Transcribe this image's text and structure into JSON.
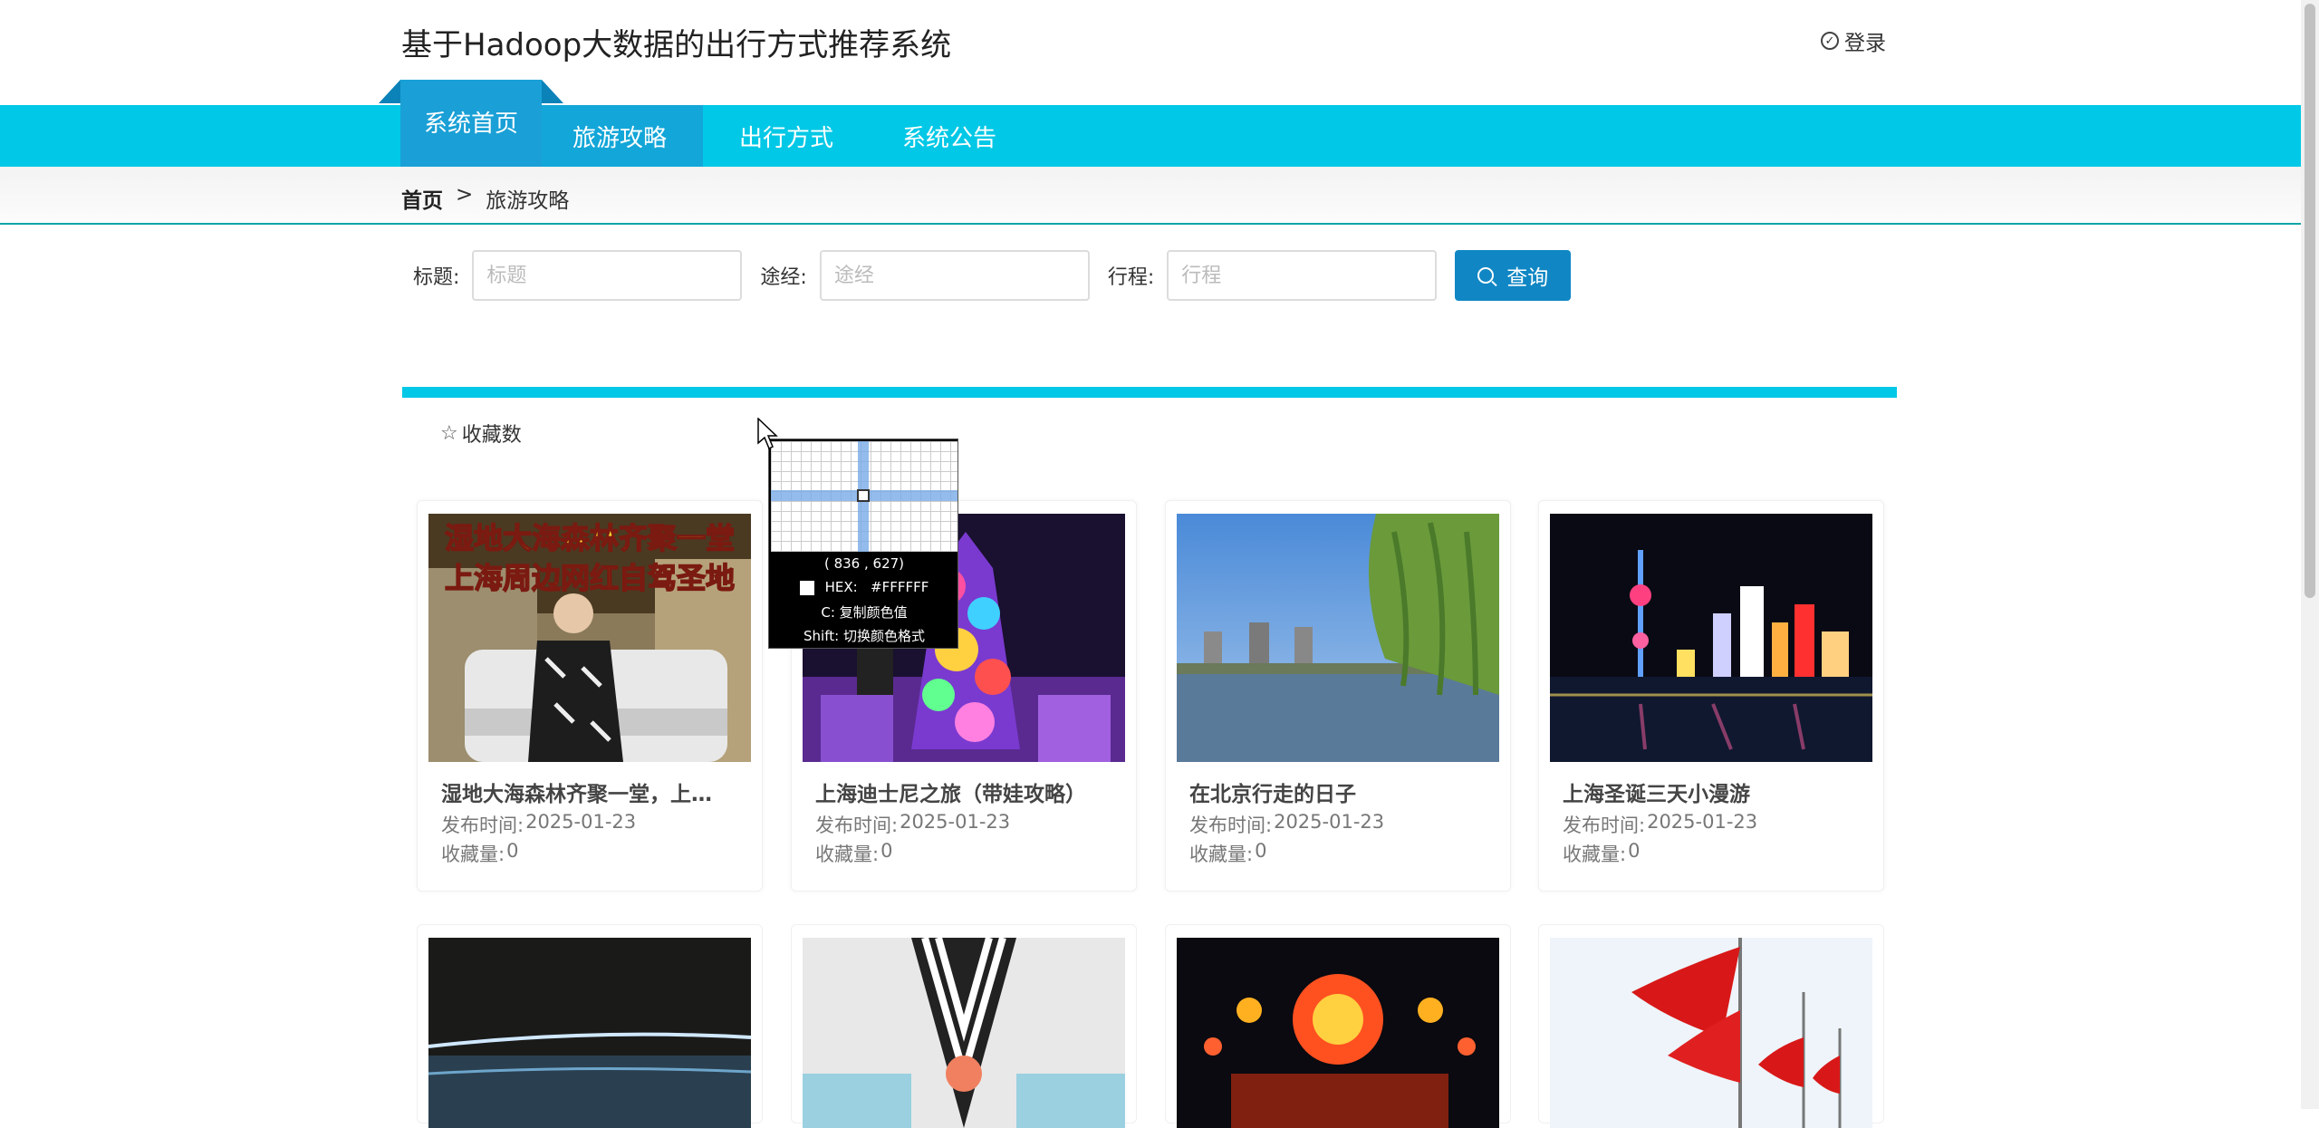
{
  "header": {
    "site_title": "基于Hadoop大数据的出行方式推荐系统",
    "login_label": "登录",
    "login_icon": "check-circle-icon"
  },
  "nav": {
    "items": [
      {
        "label": "系统首页"
      },
      {
        "label": "旅游攻略"
      },
      {
        "label": "出行方式"
      },
      {
        "label": "系统公告"
      }
    ]
  },
  "breadcrumb": {
    "home": "首页",
    "separator": ">",
    "current": "旅游攻略"
  },
  "search": {
    "title_label": "标题:",
    "title_placeholder": "标题",
    "route_label": "途经:",
    "route_placeholder": "途经",
    "trip_label": "行程:",
    "trip_placeholder": "行程",
    "button_label": "查询"
  },
  "sort": {
    "fav_label": "收藏数"
  },
  "cards": [
    {
      "title": "湿地大海森林齐聚一堂，上海...",
      "date_label": "发布时间:",
      "date": "2025-01-23",
      "fav_label": "收藏量:",
      "fav": "0"
    },
    {
      "title": "上海迪士尼之旅（带娃攻略）",
      "date_label": "发布时间:",
      "date": "2025-01-23",
      "fav_label": "收藏量:",
      "fav": "0"
    },
    {
      "title": "在北京行走的日子",
      "date_label": "发布时间:",
      "date": "2025-01-23",
      "fav_label": "收藏量:",
      "fav": "0"
    },
    {
      "title": "上海圣诞三天小漫游",
      "date_label": "发布时间:",
      "date": "2025-01-23",
      "fav_label": "收藏量:",
      "fav": "0"
    }
  ],
  "thumb_text": {
    "line1": "湿地大海森林齐聚一堂",
    "line2": "上海周边网红自驾圣地"
  },
  "picker": {
    "coords": "( 836 , 627)",
    "hex_label": "HEX:",
    "hex_value": "#FFFFFF",
    "copy_hint": "C: 复制颜色值",
    "shift_hint": "Shift: 切换颜色格式"
  },
  "colors": {
    "nav_bg": "#00c8e6",
    "nav_active": "#13a6d8",
    "home_tab": "#1aa0d6",
    "button": "#1087c4",
    "divider": "#00c8e6"
  }
}
